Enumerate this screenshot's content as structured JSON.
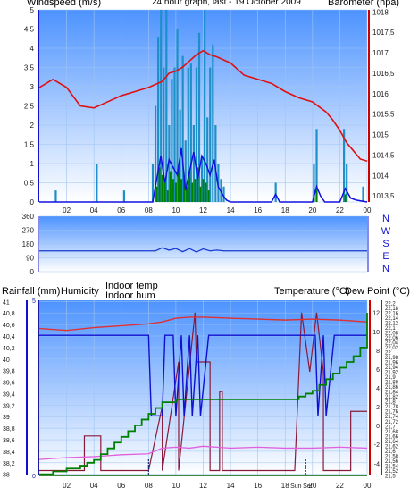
{
  "colors": {
    "bg_top": "#4d93ff",
    "bg_bottom": "#ffffff",
    "grid": "#9fc4f0",
    "axis_text": "#1a1a1a",
    "wind": "#1e8fc8",
    "gust": "#1010e0",
    "baro": "#e01010",
    "dir": "#1a3ad0",
    "rain": "#008000",
    "humidity": "#1010d0",
    "indoor_temp": "#8a1a3a",
    "temp": "#e03030",
    "dew": "#e060e0",
    "indoor_hum": "#006400",
    "red_axis": "#cc0000",
    "blue_axis": "#1010d0",
    "hum_axis": "#1a1aa0",
    "title_yellow": "#e8e800",
    "dark_red_axis": "#8a1a3a"
  },
  "header": {
    "windspeed_label": "Windspeed (m/s)",
    "title": "24 hour graph, last - 19 October 2009",
    "barometer_label": "Barometer (hpa)"
  },
  "bottom_header": {
    "rainfall_label": "Rainfall (mm)",
    "humidity_label": "Humidity",
    "indoor_temp_label": "Indoor temp",
    "indoor_hum_label": "Indoor hum",
    "temperature_label": "Temperature (°C)",
    "dewpoint_label": "Dew Point (°C)"
  },
  "direction_labels": [
    "N",
    "W",
    "S",
    "E",
    "N"
  ],
  "sun_label": "Sun",
  "set_label": "Set",
  "chart_data": [
    {
      "type": "line",
      "x_ticks": [
        "02",
        "04",
        "06",
        "08",
        "10",
        "12",
        "14",
        "16",
        "18",
        "20",
        "22",
        "00"
      ],
      "ylabel": "Windspeed (m/s)",
      "ylim": [
        0,
        5
      ],
      "y_ticks": [
        "0",
        "0,5",
        "1",
        "1,5",
        "2",
        "2,5",
        "3",
        "3,5",
        "4",
        "4,5",
        "5"
      ],
      "y2label": "Barometer (hpa)",
      "y2lim": [
        1013.35,
        1018.05
      ],
      "y2_ticks": [
        "1013,5",
        "1014",
        "1014,5",
        "1015",
        "1015,5",
        "1016",
        "1016,5",
        "1017",
        "1017,5",
        "1018"
      ],
      "grid": true,
      "series": [
        {
          "name": "Barometer (hpa)",
          "axis": "right",
          "x": [
            0,
            1,
            2,
            3,
            4,
            5,
            6,
            7,
            8,
            9,
            9.5,
            10,
            10.5,
            11,
            11.5,
            12,
            12.5,
            13,
            14,
            15,
            16,
            17,
            18,
            19,
            20,
            21,
            21.5,
            22,
            22.5,
            23,
            23.5,
            24
          ],
          "values": [
            1016.15,
            1016.35,
            1016.15,
            1015.7,
            1015.65,
            1015.8,
            1015.95,
            1016.05,
            1016.15,
            1016.3,
            1016.5,
            1016.55,
            1016.65,
            1016.8,
            1016.95,
            1017.05,
            1016.95,
            1016.9,
            1016.75,
            1016.45,
            1016.35,
            1016.25,
            1016.05,
            1015.9,
            1015.8,
            1015.55,
            1015.35,
            1015.1,
            1014.8,
            1014.6,
            1014.4,
            1014.35
          ]
        },
        {
          "name": "Gust (m/s)",
          "axis": "left",
          "type": "bar",
          "x": [
            1.2,
            4.2,
            6.2,
            8.3,
            8.5,
            8.7,
            8.9,
            9.1,
            9.3,
            9.5,
            9.7,
            9.9,
            10.1,
            10.3,
            10.5,
            10.7,
            10.9,
            11.1,
            11.3,
            11.5,
            11.7,
            11.9,
            12.1,
            12.3,
            12.5,
            12.7,
            12.9,
            13.1,
            13.3,
            13.5,
            17.3,
            20.1,
            20.3,
            22.3,
            22.5,
            23.7
          ],
          "values": [
            0.3,
            1.0,
            0.3,
            1.0,
            2.5,
            4.3,
            5.0,
            3.5,
            5.0,
            2.0,
            3.2,
            3.5,
            4.5,
            2.4,
            3.8,
            1.6,
            3.5,
            3.6,
            2.0,
            3.5,
            4.4,
            1.2,
            5.0,
            2.2,
            3.5,
            4.1,
            2.0,
            1.0,
            0.6,
            0.4,
            0.5,
            1.0,
            1.9,
            1.9,
            1.0,
            0.4
          ]
        },
        {
          "name": "Windspeed (m/s)",
          "axis": "left",
          "x": [
            0,
            8.3,
            8.6,
            8.9,
            9.2,
            9.5,
            9.8,
            10.1,
            10.4,
            10.7,
            11.0,
            11.3,
            11.6,
            11.9,
            12.2,
            12.5,
            12.8,
            13.1,
            13.4,
            13.7,
            14,
            17,
            17.3,
            17.6,
            20,
            20.3,
            20.6,
            20.9,
            22,
            22.4,
            22.8,
            23.2,
            24
          ],
          "values": [
            0,
            0,
            0.6,
            1.2,
            0.5,
            1.1,
            0.9,
            0.7,
            1.4,
            0.3,
            0.8,
            1.3,
            0.6,
            1.2,
            1.0,
            0.7,
            1.1,
            0.4,
            0.2,
            0.05,
            0,
            0,
            0.2,
            0,
            0,
            0.4,
            0.15,
            0,
            0,
            0.35,
            0.1,
            0.05,
            0
          ]
        },
        {
          "name": "Calm wind",
          "axis": "left",
          "type": "bar",
          "x": [
            8.6,
            8.8,
            9.0,
            9.2,
            9.4,
            9.6,
            9.8,
            10.0,
            10.2,
            10.4,
            10.6,
            10.8,
            11.0,
            11.2,
            11.4,
            11.6,
            11.8,
            12.0,
            12.2,
            12.4,
            20.1,
            20.3,
            22.4
          ],
          "values": [
            0.4,
            0.9,
            0.7,
            0.5,
            0.3,
            0.8,
            0.6,
            0.5,
            0.9,
            0.6,
            0.7,
            0.4,
            0.8,
            0.5,
            0.6,
            0.9,
            0.4,
            0.6,
            0.5,
            0.3,
            0.2,
            0.3,
            0.2
          ]
        }
      ]
    },
    {
      "type": "line",
      "ylim": [
        0,
        360
      ],
      "y_ticks": [
        "0",
        "90",
        "180",
        "270",
        "360"
      ],
      "grid": true,
      "series": [
        {
          "name": "Wind direction",
          "x": [
            0,
            8.5,
            9,
            9.5,
            10,
            10.5,
            11,
            11.5,
            12,
            12.5,
            13,
            13.5,
            24
          ],
          "values": [
            135,
            135,
            155,
            140,
            150,
            130,
            150,
            128,
            148,
            135,
            140,
            135,
            135
          ]
        }
      ]
    },
    {
      "type": "line",
      "x_ticks": [
        "02",
        "04",
        "06",
        "08",
        "10",
        "12",
        "14",
        "16",
        "18",
        "20",
        "22",
        "00"
      ],
      "grid": true,
      "axes": [
        {
          "name": "Rainfall (mm)",
          "lim": [
            37.98,
            41.02
          ],
          "ticks": [
            "38",
            "38,2",
            "38,4",
            "38,6",
            "38,8",
            "39",
            "39,2",
            "39,4",
            "39,6",
            "39,8",
            "40",
            "40,2",
            "40,4",
            "40,6",
            "40,8",
            "41"
          ]
        },
        {
          "name": "Humidity",
          "lim": [
            0,
            5
          ],
          "ticks": [
            "0",
            "5"
          ]
        },
        {
          "name": "Temperature (°C)",
          "lim": [
            -5.3,
            13.3
          ],
          "ticks": [
            "-4",
            "-2",
            "0",
            "2",
            "4",
            "6",
            "8",
            "10",
            "12"
          ]
        },
        {
          "name": "Indoor",
          "lim": [
            21.5,
            22.21
          ],
          "ticks": [
            "21,5",
            "21,52",
            "21,54",
            "21,56",
            "21,58",
            "21,6",
            "21,62",
            "21,64",
            "21,66",
            "21,68",
            "21,7",
            "21,72",
            "21,74",
            "21,76",
            "21,78",
            "21,8",
            "21,82",
            "21,84",
            "21,86",
            "21,88",
            "21,9",
            "21,92",
            "21,94",
            "21,96",
            "21,98",
            "22",
            "22,02",
            "22,04",
            "22,06",
            "22,08",
            "22,1",
            "22,12",
            "22,14",
            "22,16",
            "22,18",
            "22,2"
          ]
        }
      ],
      "series": [
        {
          "name": "Rainfall (mm)",
          "axis": "Rainfall (mm)",
          "x": [
            0,
            1,
            2,
            3,
            3.5,
            4,
            4.5,
            5,
            5.5,
            6,
            6.5,
            7,
            7.5,
            8,
            8.5,
            9,
            10,
            12,
            14,
            16,
            18,
            19,
            19.5,
            20,
            20.5,
            21,
            21.5,
            22,
            22.5,
            23,
            23.5,
            24
          ],
          "values": [
            38.0,
            38.05,
            38.1,
            38.15,
            38.2,
            38.25,
            38.35,
            38.45,
            38.55,
            38.65,
            38.75,
            38.85,
            38.95,
            39.05,
            39.15,
            39.25,
            39.3,
            39.3,
            39.3,
            39.3,
            39.3,
            39.35,
            39.4,
            39.45,
            39.55,
            39.65,
            39.75,
            39.85,
            39.95,
            40.05,
            40.2,
            40.8
          ]
        },
        {
          "name": "Humidity",
          "axis": "Humidity",
          "x": [
            0,
            8,
            8.2,
            9.0,
            9.2,
            9.8,
            10.0,
            10.4,
            10.6,
            11.0,
            11.2,
            11.6,
            11.8,
            12.4,
            12.6,
            20.2,
            20.4,
            20.8,
            21.0,
            21.6,
            21.8,
            24
          ],
          "values": [
            4.0,
            4.0,
            1.7,
            1.7,
            4.0,
            4.0,
            1.7,
            4.0,
            1.7,
            4.0,
            1.7,
            4.0,
            1.7,
            4.0,
            4.0,
            4.0,
            1.7,
            4.0,
            1.7,
            4.0,
            4.0,
            4.0
          ]
        },
        {
          "name": "Temperature (°C)",
          "axis": "Temperature (°C)",
          "x": [
            0,
            2,
            4,
            6,
            8,
            9,
            10,
            11,
            12,
            14,
            16,
            18,
            20,
            22,
            24
          ],
          "values": [
            10.3,
            10.1,
            10.4,
            10.6,
            10.8,
            11.0,
            11.4,
            11.5,
            11.5,
            11.4,
            11.3,
            11.2,
            11.3,
            11.2,
            11.0
          ]
        },
        {
          "name": "Dew Point (°C)",
          "axis": "Temperature (°C)",
          "x": [
            0,
            2,
            4,
            6,
            8,
            9,
            10,
            11,
            12,
            14,
            16,
            18,
            20,
            22,
            24
          ],
          "values": [
            -3.6,
            -3.4,
            -3.3,
            -3.1,
            -3.0,
            -2.4,
            -2.3,
            -2.4,
            -2.2,
            -2.4,
            -2.3,
            -2.4,
            -2.4,
            -2.3,
            -2.4
          ]
        },
        {
          "name": "Indoor temp",
          "axis": "Indoor",
          "x": [
            0,
            3.3,
            3.3,
            4.5,
            4.5,
            8.0,
            9.0,
            9.0,
            10.2,
            10.2,
            11.4,
            11.5,
            11.6,
            11.8,
            12.5,
            12.5,
            13.2,
            13.2,
            13.4,
            13.4,
            18.7,
            19.2,
            19.8,
            20.3,
            20.8,
            20.8,
            22.8,
            22.8,
            24
          ],
          "values": [
            21.52,
            21.52,
            21.66,
            21.66,
            21.52,
            21.52,
            21.78,
            21.52,
            21.96,
            21.52,
            22.16,
            21.96,
            21.96,
            21.96,
            21.96,
            21.52,
            21.52,
            21.84,
            21.84,
            21.52,
            21.52,
            22.16,
            21.92,
            22.16,
            21.92,
            21.52,
            21.52,
            21.76,
            21.76
          ]
        },
        {
          "name": "Indoor hum",
          "axis": "Indoor",
          "x": [
            0,
            7,
            8,
            8.5,
            9,
            9.5,
            10,
            10.5,
            11,
            11.5,
            12,
            12.5,
            13,
            24
          ],
          "values": [
            21.5,
            21.5,
            21.5,
            21.5,
            21.5,
            21.5,
            21.5,
            21.5,
            21.5,
            21.5,
            21.5,
            21.5,
            21.5,
            21.5
          ]
        }
      ]
    }
  ]
}
